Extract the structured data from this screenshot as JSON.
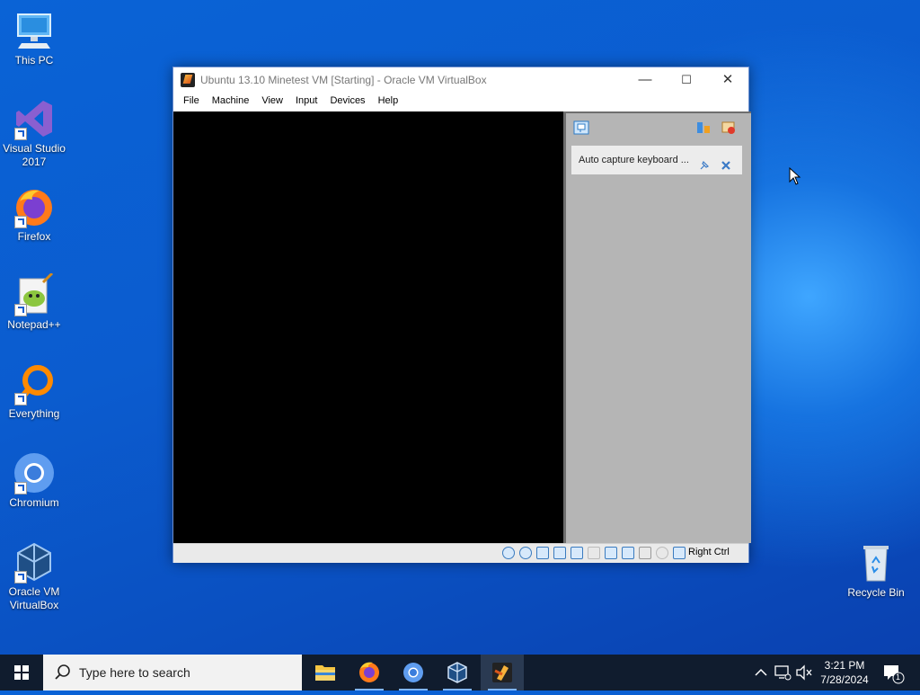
{
  "desktop": {
    "icons": [
      {
        "label_line1": "This PC",
        "label_line2": ""
      },
      {
        "label_line1": "Visual Studio",
        "label_line2": "2017"
      },
      {
        "label_line1": "Firefox",
        "label_line2": ""
      },
      {
        "label_line1": "Notepad++",
        "label_line2": ""
      },
      {
        "label_line1": "Everything",
        "label_line2": ""
      },
      {
        "label_line1": "Chromium",
        "label_line2": ""
      },
      {
        "label_line1": "Oracle VM",
        "label_line2": "VirtualBox"
      },
      {
        "label_line1": "Recycle Bin",
        "label_line2": ""
      }
    ]
  },
  "window": {
    "title": "Ubuntu 13.10 Minetest VM [Starting] - Oracle VM VirtualBox",
    "controls": {
      "minimize": "—",
      "maximize": "☐",
      "close": "✕"
    },
    "menu": [
      "File",
      "Machine",
      "View",
      "Input",
      "Devices",
      "Help"
    ],
    "notice": "Auto capture keyboard ...",
    "host_key": "Right Ctrl"
  },
  "taskbar": {
    "search_placeholder": "Type here to search",
    "clock_time": "3:21 PM",
    "clock_date": "7/28/2024",
    "notification_count": "1"
  },
  "colors": {
    "accent": "#1a6fe0",
    "taskbar": "#101c2e",
    "vm_panel": "#b5b5b5"
  }
}
